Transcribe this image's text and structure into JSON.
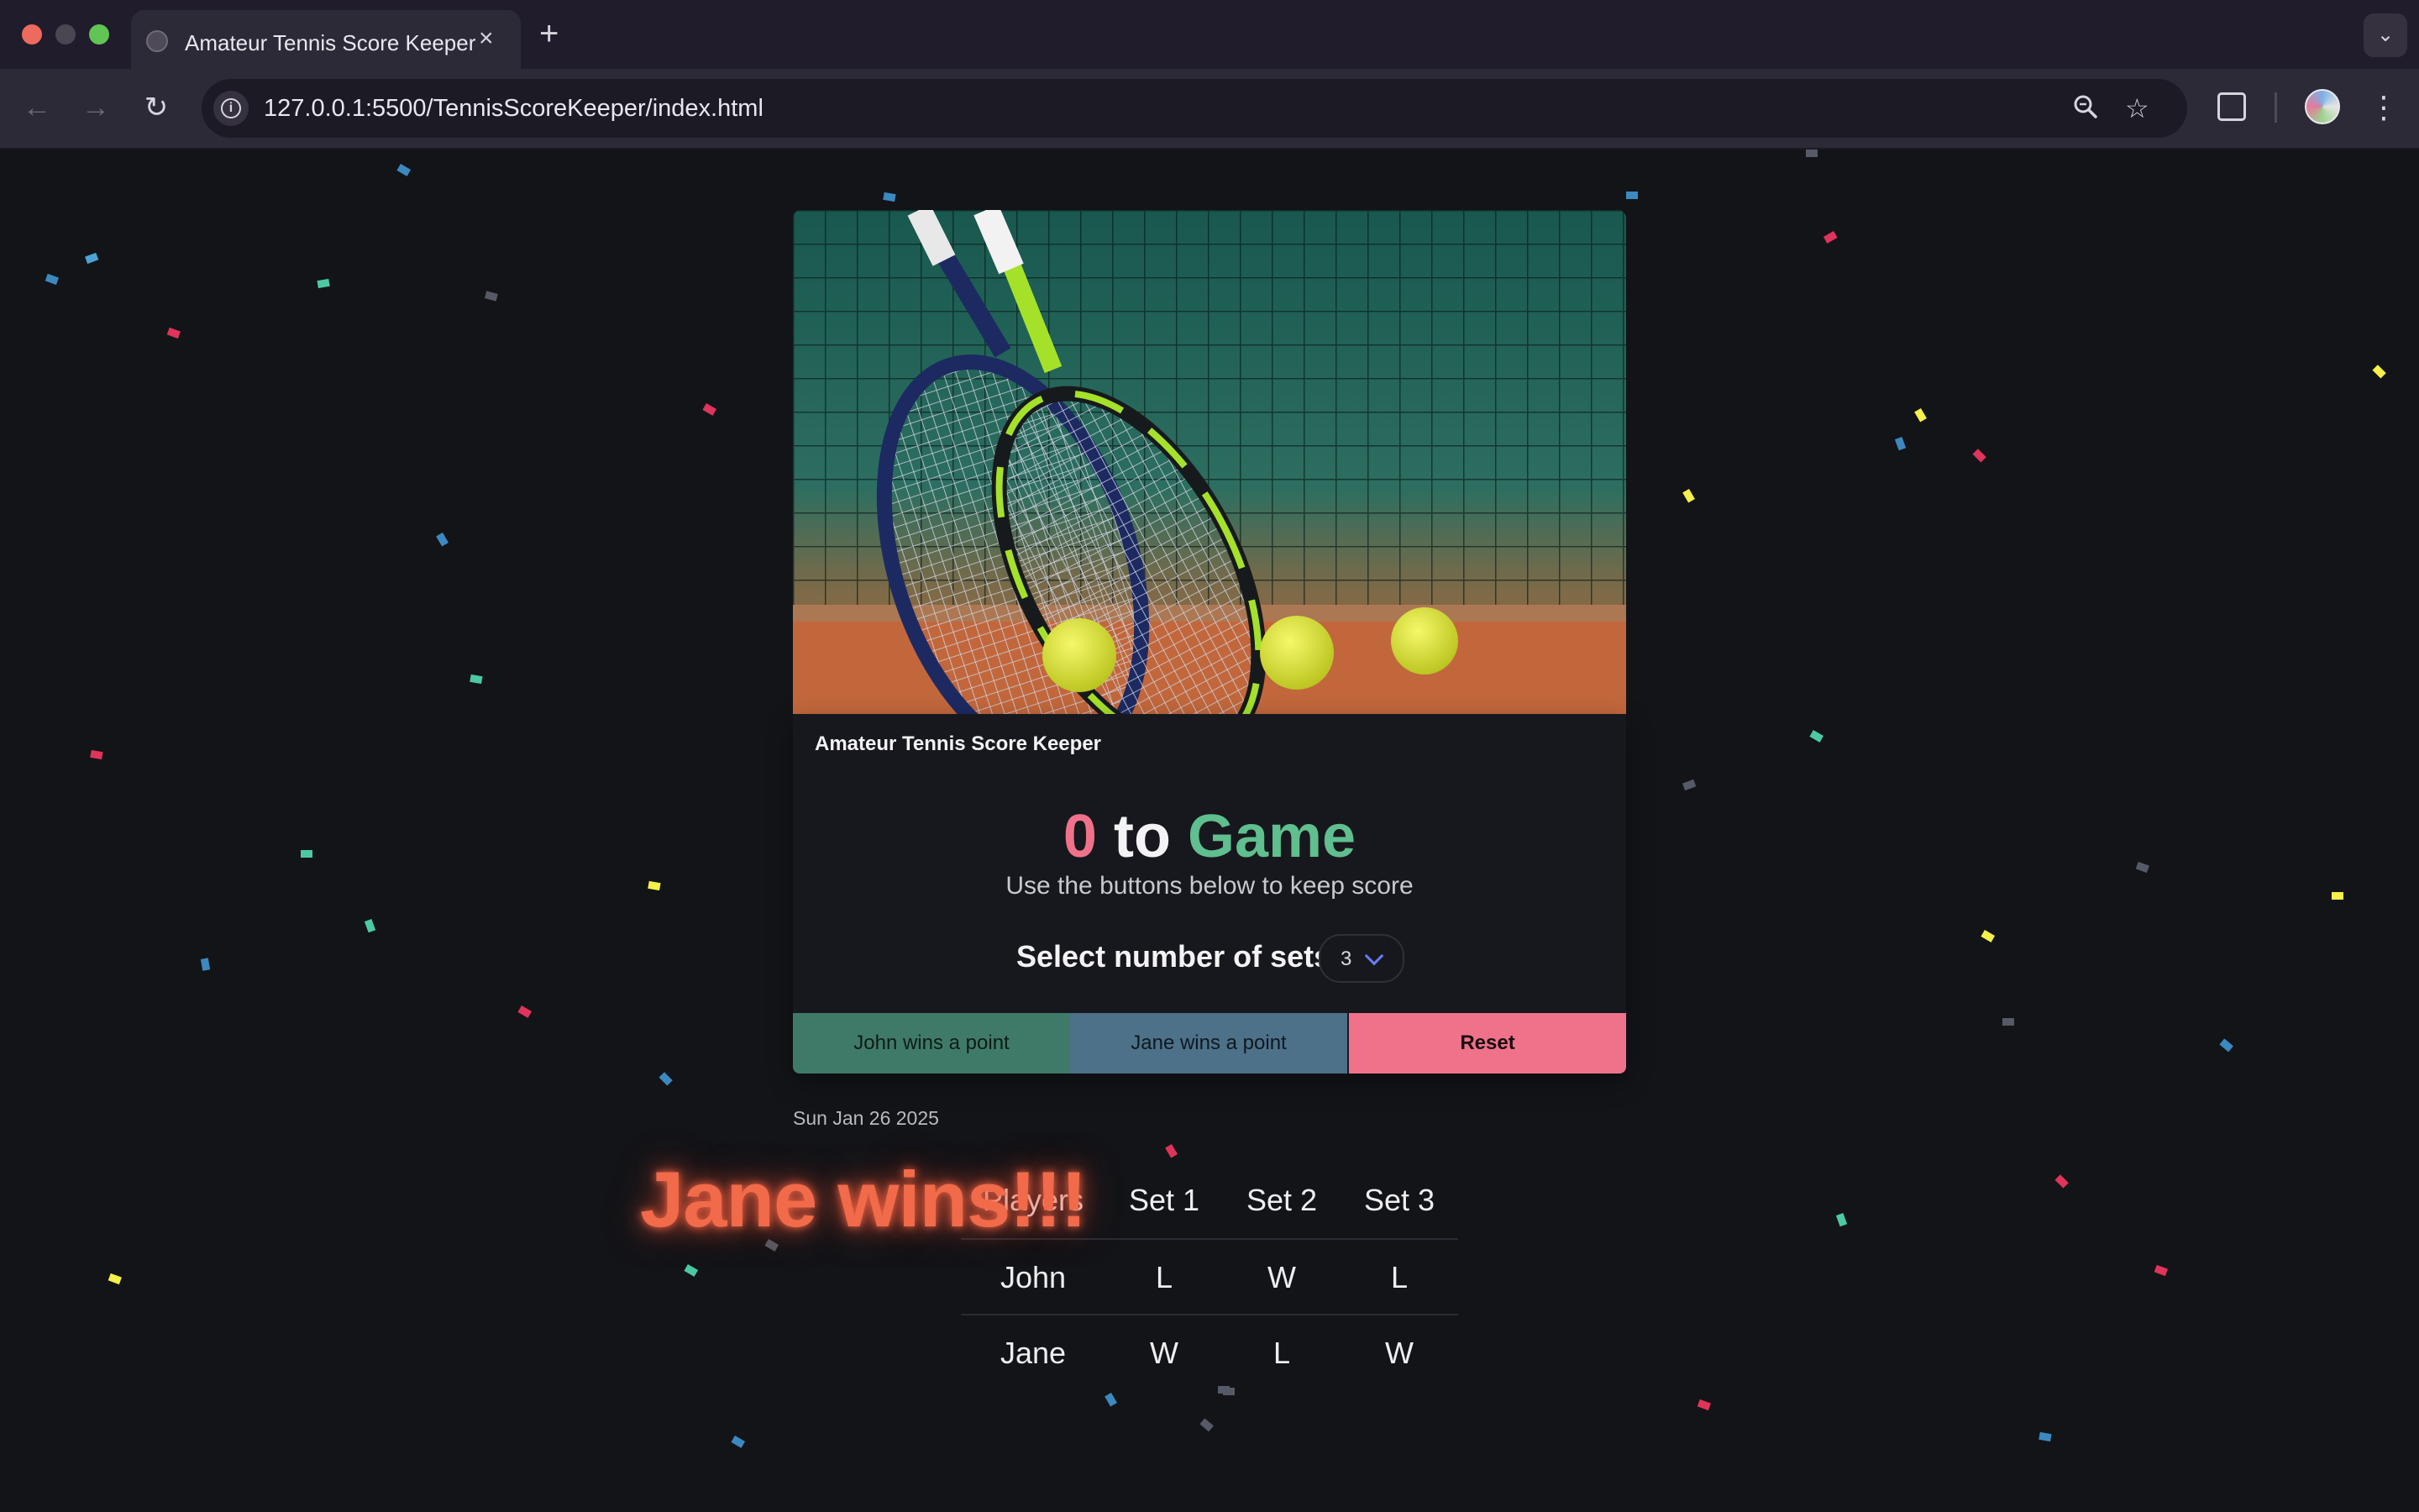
{
  "browser": {
    "tab_title": "Amateur Tennis Score Keeper",
    "url": "127.0.0.1:5500/TennisScoreKeeper/index.html",
    "icons": [
      "back-arrow-icon",
      "forward-arrow-icon",
      "reload-icon",
      "site-info-icon",
      "zoom-icon",
      "star-icon",
      "extensions-icon",
      "profile-avatar",
      "more-menu-icon"
    ]
  },
  "app": {
    "title": "Amateur Tennis Score Keeper",
    "score": {
      "john": "0",
      "to": "to",
      "jane": "Game"
    },
    "subtitle": "Use the buttons below to keep score",
    "sets_label": "Select number of sets",
    "sets_value": "3",
    "buttons": {
      "john": "John wins a point",
      "jane": "Jane wins a point",
      "reset": "Reset"
    },
    "date": "Sun Jan 26 2025",
    "winner_text": "Jane wins!!!",
    "results": {
      "headers": [
        "Players",
        "Set 1",
        "Set 2",
        "Set 3"
      ],
      "rows": [
        [
          "John",
          "L",
          "W",
          "L"
        ],
        [
          "Jane",
          "W",
          "L",
          "W"
        ]
      ]
    }
  },
  "colors": {
    "john_accent": "#f0728a",
    "jane_accent": "#5fbf8e",
    "john_button": "#3f7a68",
    "jane_button": "#4c7188",
    "reset_button": "#f0728a",
    "winner_text": "#f16a4a",
    "page_background": "#131418"
  }
}
